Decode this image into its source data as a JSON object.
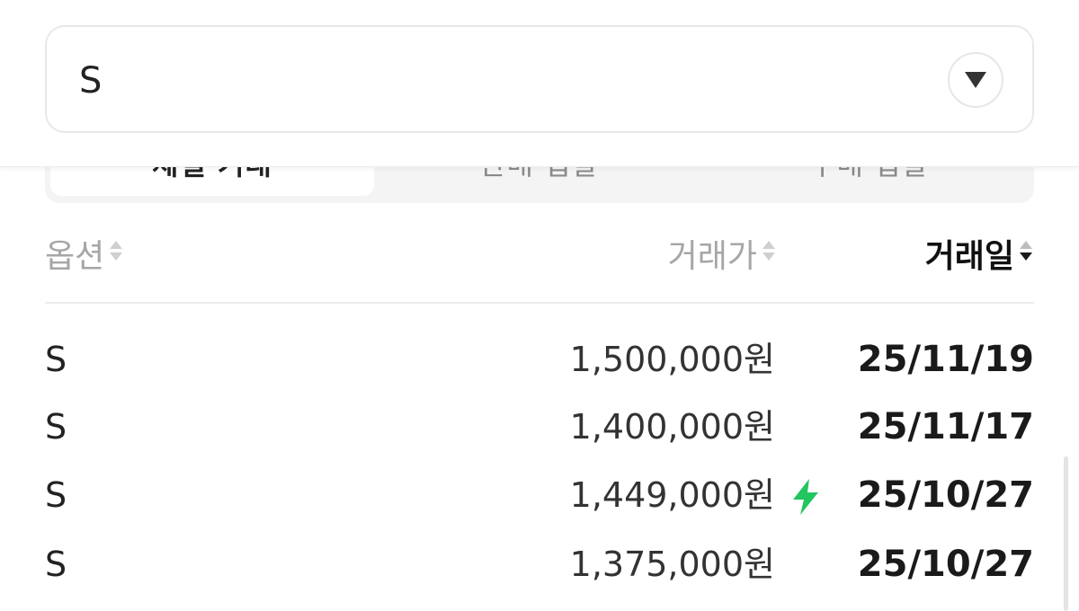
{
  "select": {
    "value": "S",
    "caret_icon": "triangle-down-icon"
  },
  "tabs": [
    {
      "label": "체결 거래",
      "active": true
    },
    {
      "label": "판매 입찰",
      "active": false
    },
    {
      "label": "구매 입찰",
      "active": false
    }
  ],
  "table": {
    "headers": {
      "option": "옵션",
      "price": "거래가",
      "date": "거래일"
    },
    "sorted_column": "date",
    "rows": [
      {
        "option": "S",
        "price": "1,500,000원",
        "flash": false,
        "date": "25/11/19"
      },
      {
        "option": "S",
        "price": "1,400,000원",
        "flash": false,
        "date": "25/11/17"
      },
      {
        "option": "S",
        "price": "1,449,000원",
        "flash": true,
        "date": "25/10/27"
      },
      {
        "option": "S",
        "price": "1,375,000원",
        "flash": false,
        "date": "25/10/27"
      }
    ]
  },
  "colors": {
    "flash": "#22c55e",
    "header_inactive": "#a6a6a6",
    "header_active": "#111111",
    "divider": "#ececec"
  },
  "icons": {
    "sort": "sort-arrows-icon",
    "flash": "lightning-bolt-icon"
  }
}
